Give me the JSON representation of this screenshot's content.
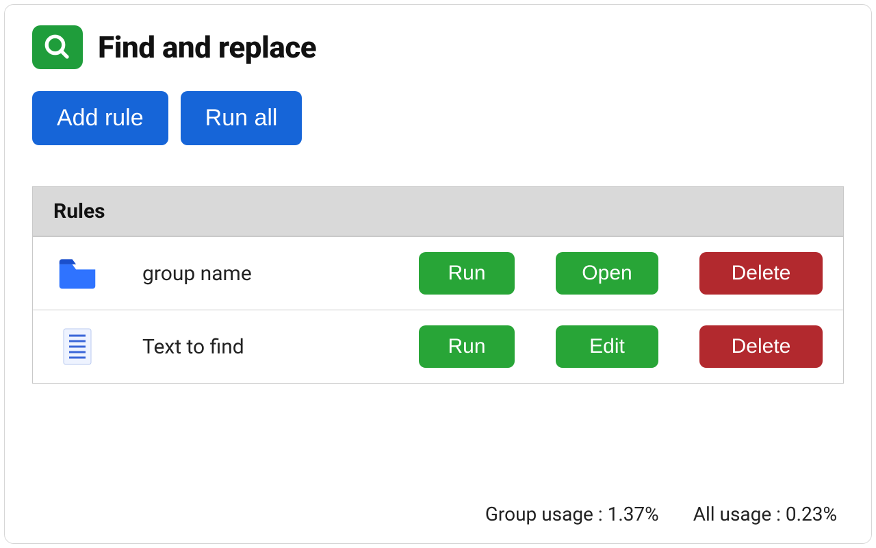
{
  "header": {
    "title": "Find and replace"
  },
  "toolbar": {
    "add_rule_label": "Add rule",
    "run_all_label": "Run all"
  },
  "rules_section": {
    "header": "Rules",
    "rows": [
      {
        "icon": "folder",
        "label": "group name",
        "actions": {
          "run": "Run",
          "secondary": "Open",
          "delete": "Delete"
        }
      },
      {
        "icon": "document",
        "label": "Text to find",
        "actions": {
          "run": "Run",
          "secondary": "Edit",
          "delete": "Delete"
        }
      }
    ]
  },
  "footer": {
    "group_usage_label": "Group usage :",
    "group_usage_value": "1.37%",
    "all_usage_label": "All usage :",
    "all_usage_value": "0.23%"
  }
}
